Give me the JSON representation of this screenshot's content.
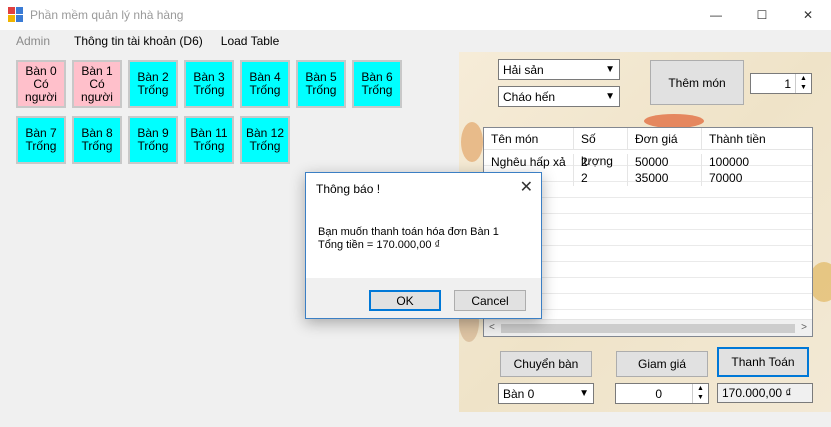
{
  "window": {
    "title": "Phần mềm quản lý nhà hàng",
    "minimize": "—",
    "maximize": "☐",
    "close": "✕"
  },
  "menu": {
    "admin": "Admin",
    "account": "Thông tin tài khoản (D6)",
    "load_table": "Load Table"
  },
  "tables": [
    {
      "text": "Bàn 0\nCó\nngười",
      "status": "occupied"
    },
    {
      "text": "Bàn 1\nCó\nngười",
      "status": "occupied"
    },
    {
      "text": "Bàn 2\nTrống",
      "status": "free"
    },
    {
      "text": "Bàn 3\nTrống",
      "status": "free"
    },
    {
      "text": "Bàn 4\nTrống",
      "status": "free"
    },
    {
      "text": "Bàn 5\nTrống",
      "status": "free"
    },
    {
      "text": "Bàn 6\nTrống",
      "status": "free"
    },
    {
      "text": "Bàn 7\nTrống",
      "status": "free"
    },
    {
      "text": "Bàn 8\nTrống",
      "status": "free"
    },
    {
      "text": "Bàn 9\nTrống",
      "status": "free"
    },
    {
      "text": "Bàn 11\nTrống",
      "status": "free"
    },
    {
      "text": "Bàn 12\nTrống",
      "status": "free"
    }
  ],
  "order": {
    "category": "Hải sản",
    "food": "Cháo hến",
    "add_button": "Thêm món",
    "quantity": "1",
    "columns": [
      "Tên món",
      "Số lượng",
      "Đơn giá",
      "Thành tiền"
    ],
    "rows": [
      [
        "Nghêu hấp xả",
        "2",
        "50000",
        "100000"
      ],
      [
        "",
        "2",
        "35000",
        "70000"
      ]
    ]
  },
  "actions": {
    "switch_button": "Chuyển bàn",
    "discount_button": "Giam giá",
    "checkout_button": "Thanh Toán",
    "switch_target": "Bàn 0",
    "discount_value": "0",
    "total": "170.000,00 ₫"
  },
  "dialog": {
    "title": "Thông báo !",
    "line1": "Bạn muốn thanh toán hóa đơn Bàn 1",
    "line2": "Tổng tiền = 170.000,00 ₫",
    "ok": "OK",
    "cancel": "Cancel"
  },
  "colors": {
    "occupied": "#ffc0cb",
    "free": "#00ffff",
    "accent": "#0078d7"
  }
}
